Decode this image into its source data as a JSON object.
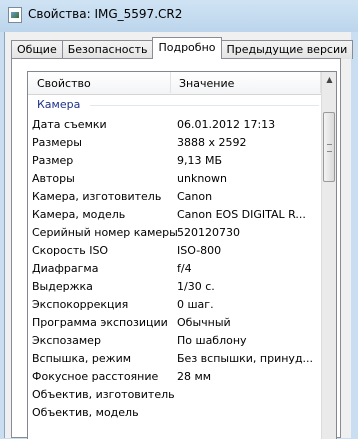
{
  "window": {
    "title": "Свойства: IMG_5597.CR2",
    "icon": "file-image-icon"
  },
  "tabs": [
    {
      "label": "Общие",
      "active": false
    },
    {
      "label": "Безопасность",
      "active": false
    },
    {
      "label": "Подробно",
      "active": true
    },
    {
      "label": "Предыдущие версии",
      "active": false
    }
  ],
  "list": {
    "columns": [
      "Свойство",
      "Значение"
    ],
    "group": "Камера",
    "rows": [
      {
        "name": "Дата съемки",
        "value": "06.01.2012 17:13"
      },
      {
        "name": "Размеры",
        "value": "3888 x 2592"
      },
      {
        "name": "Размер",
        "value": "9,13 МБ"
      },
      {
        "name": "Авторы",
        "value": "unknown"
      },
      {
        "name": "Камера, изготовитель",
        "value": "Canon"
      },
      {
        "name": "Камера, модель",
        "value": "Canon EOS DIGITAL R..."
      },
      {
        "name": "Серийный номер камеры",
        "value": "520120730"
      },
      {
        "name": "Скорость ISO",
        "value": "ISO-800"
      },
      {
        "name": "Диафрагма",
        "value": "f/4"
      },
      {
        "name": "Выдержка",
        "value": "1/30 с."
      },
      {
        "name": "Экспокоррекция",
        "value": "0 шаг."
      },
      {
        "name": "Программа экспозиции",
        "value": "Обычный"
      },
      {
        "name": "Экспозамер",
        "value": "По шаблону"
      },
      {
        "name": "Вспышка, режим",
        "value": "Без вспышки, принуд..."
      },
      {
        "name": "Фокусное расстояние",
        "value": "28 мм"
      },
      {
        "name": "Объектив, изготовитель",
        "value": ""
      },
      {
        "name": "Объектив, модель",
        "value": ""
      }
    ]
  }
}
